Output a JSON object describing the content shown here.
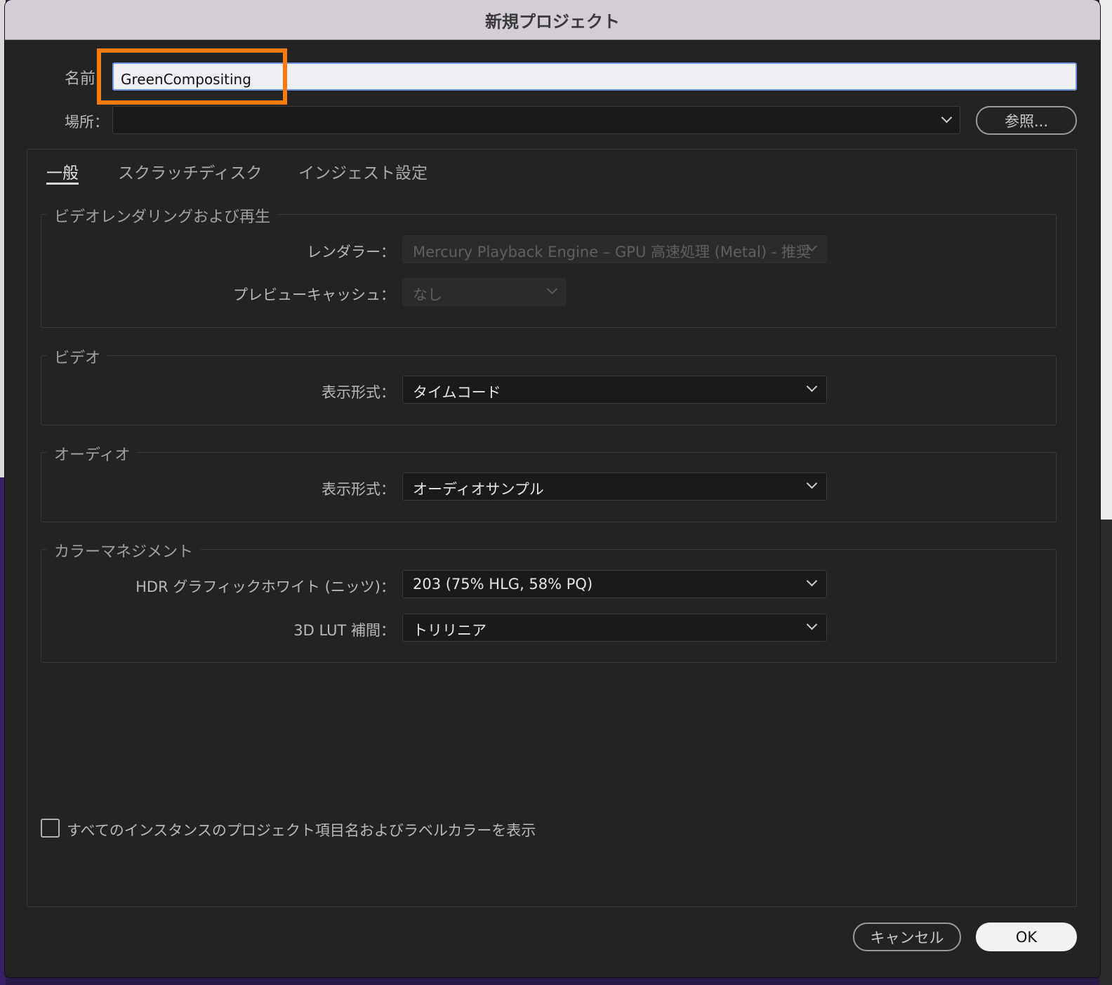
{
  "window": {
    "title": "新規プロジェクト"
  },
  "name": {
    "label": "名前",
    "value": "GreenCompositing"
  },
  "location": {
    "label": "場所：",
    "value": "",
    "browse_label": "参照..."
  },
  "tabs": [
    {
      "label": "一般",
      "active": true
    },
    {
      "label": "スクラッチディスク",
      "active": false
    },
    {
      "label": "インジェスト設定",
      "active": false
    }
  ],
  "video_rendering": {
    "title": "ビデオレンダリングおよび再生",
    "renderer_label": "レンダラー：",
    "renderer_value": "Mercury Playback Engine – GPU 高速処理 (Metal) - 推奨",
    "preview_cache_label": "プレビューキャッシュ：",
    "preview_cache_value": "なし"
  },
  "video": {
    "title": "ビデオ",
    "display_format_label": "表示形式：",
    "display_format_value": "タイムコード"
  },
  "audio": {
    "title": "オーディオ",
    "display_format_label": "表示形式：",
    "display_format_value": "オーディオサンプル"
  },
  "color_management": {
    "title": "カラーマネジメント",
    "hdr_label": "HDR グラフィックホワイト (ニッツ)：",
    "hdr_value": "203 (75% HLG, 58% PQ)",
    "lut_label": "3D LUT 補間：",
    "lut_value": "トリリニア"
  },
  "show_all_instances": {
    "label": "すべてのインスタンスのプロジェクト項目名およびラベルカラーを表示",
    "checked": false
  },
  "buttons": {
    "cancel": "キャンセル",
    "ok": "OK"
  },
  "colors": {
    "highlight": "#ff7a00",
    "input_focus": "#6d97e8",
    "dialog_bg": "#232323"
  }
}
